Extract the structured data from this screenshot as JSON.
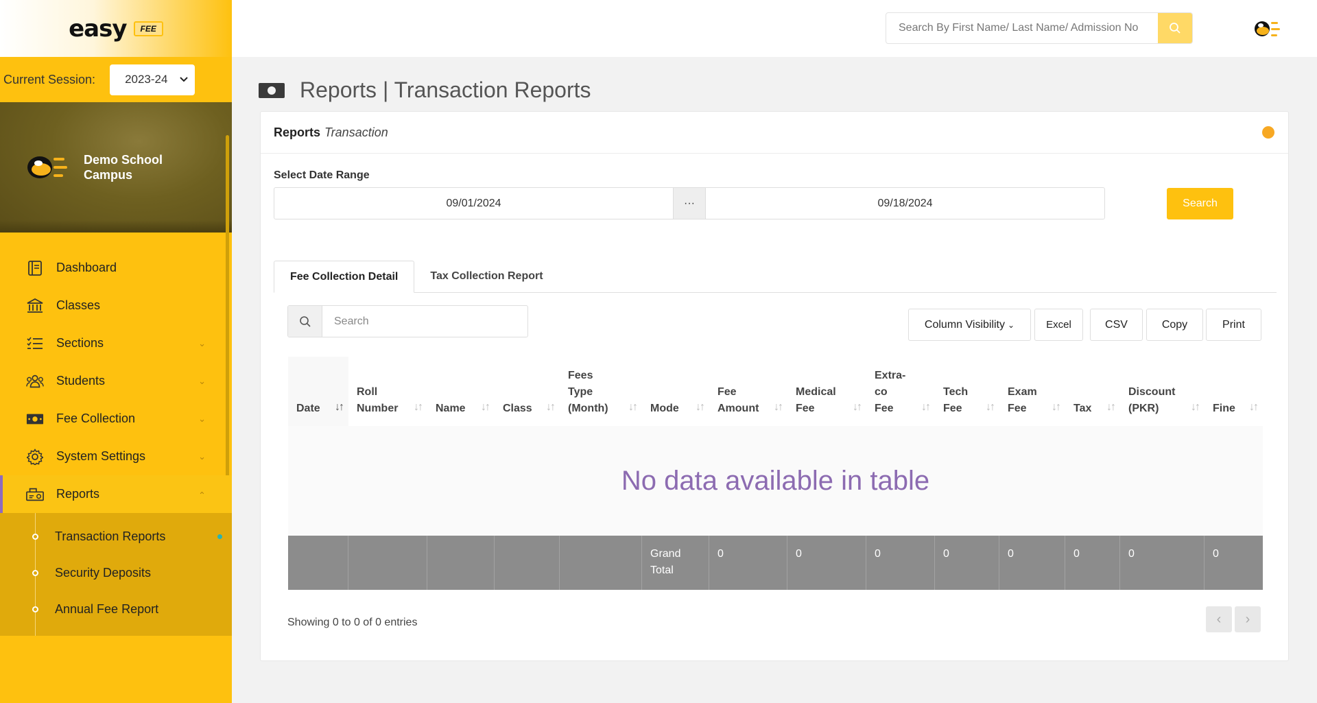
{
  "app": {
    "logo_text": "easy",
    "logo_badge": "FEE"
  },
  "session": {
    "label": "Current Session:",
    "value": "2023-24"
  },
  "campus": {
    "name": "Demo School Campus"
  },
  "sidebar": {
    "items": [
      {
        "label": "Dashboard",
        "icon": "dashboard-icon",
        "has_children": false
      },
      {
        "label": "Classes",
        "icon": "bank-icon",
        "has_children": false
      },
      {
        "label": "Sections",
        "icon": "list-check-icon",
        "has_children": true
      },
      {
        "label": "Students",
        "icon": "users-icon",
        "has_children": true
      },
      {
        "label": "Fee Collection",
        "icon": "money-icon",
        "has_children": true
      },
      {
        "label": "System Settings",
        "icon": "gear-icon",
        "has_children": true
      },
      {
        "label": "Reports",
        "icon": "report-truck-icon",
        "has_children": true,
        "expanded": true
      }
    ],
    "submenu": [
      {
        "label": "Transaction Reports",
        "active": true
      },
      {
        "label": "Security Deposits",
        "active": false
      },
      {
        "label": "Annual Fee Report",
        "active": false
      }
    ]
  },
  "topbar": {
    "search_placeholder": "Search By First Name/ Last Name/ Admission No"
  },
  "page": {
    "title": "Reports | Transaction Reports",
    "icon": "money-icon"
  },
  "card": {
    "title_bold": "Reports",
    "title_italic": "Transaction",
    "status_color": "#f7a823"
  },
  "filters": {
    "date_range_label": "Select Date Range",
    "start_date": "09/01/2024",
    "separator": "···",
    "end_date": "09/18/2024",
    "search_button": "Search"
  },
  "tabs": [
    {
      "label": "Fee Collection Detail",
      "active": true
    },
    {
      "label": "Tax Collection Report",
      "active": false
    }
  ],
  "table_controls": {
    "search_placeholder": "Search",
    "column_visibility": "Column Visibility",
    "excel": "Excel",
    "csv": "CSV",
    "copy": "Copy",
    "print": "Print"
  },
  "table": {
    "columns": [
      "Date",
      "Roll Number",
      "Name",
      "Class",
      "Fees Type (Month)",
      "Mode",
      "Fee Amount",
      "Medical Fee",
      "Extra-co Fee",
      "Tech Fee",
      "Exam Fee",
      "Tax",
      "Discount (PKR)",
      "Fine"
    ],
    "column_display": [
      [
        "Date"
      ],
      [
        "Roll",
        "Number"
      ],
      [
        "Name"
      ],
      [
        "Class"
      ],
      [
        "Fees",
        "Type",
        "(Month)"
      ],
      [
        "Mode"
      ],
      [
        "Fee",
        "Amount"
      ],
      [
        "Medical",
        "Fee"
      ],
      [
        "Extra-",
        "co",
        "Fee"
      ],
      [
        "Tech",
        "Fee"
      ],
      [
        "Exam",
        "Fee"
      ],
      [
        "Tax"
      ],
      [
        "Discount",
        "(PKR)"
      ],
      [
        "Fine"
      ]
    ],
    "empty_message": "No data available in table",
    "footer": [
      "",
      "",
      "",
      "",
      "",
      "Grand Total",
      "0",
      "0",
      "0",
      "0",
      "0",
      "0",
      "0",
      "0"
    ],
    "footer_display": [
      [
        ""
      ],
      [
        ""
      ],
      [
        ""
      ],
      [
        ""
      ],
      [
        ""
      ],
      [
        "Grand",
        "Total"
      ],
      [
        "0"
      ],
      [
        "0"
      ],
      [
        "0"
      ],
      [
        "0"
      ],
      [
        "0"
      ],
      [
        "0"
      ],
      [
        "0"
      ],
      [
        "0"
      ]
    ],
    "info": "Showing 0 to 0 of 0 entries"
  },
  "colors": {
    "accent": "#fec10f",
    "sidebar_sub": "#e0aa0c",
    "empty_text": "#8c6bb1",
    "footer_bg": "#8c8c8c"
  }
}
